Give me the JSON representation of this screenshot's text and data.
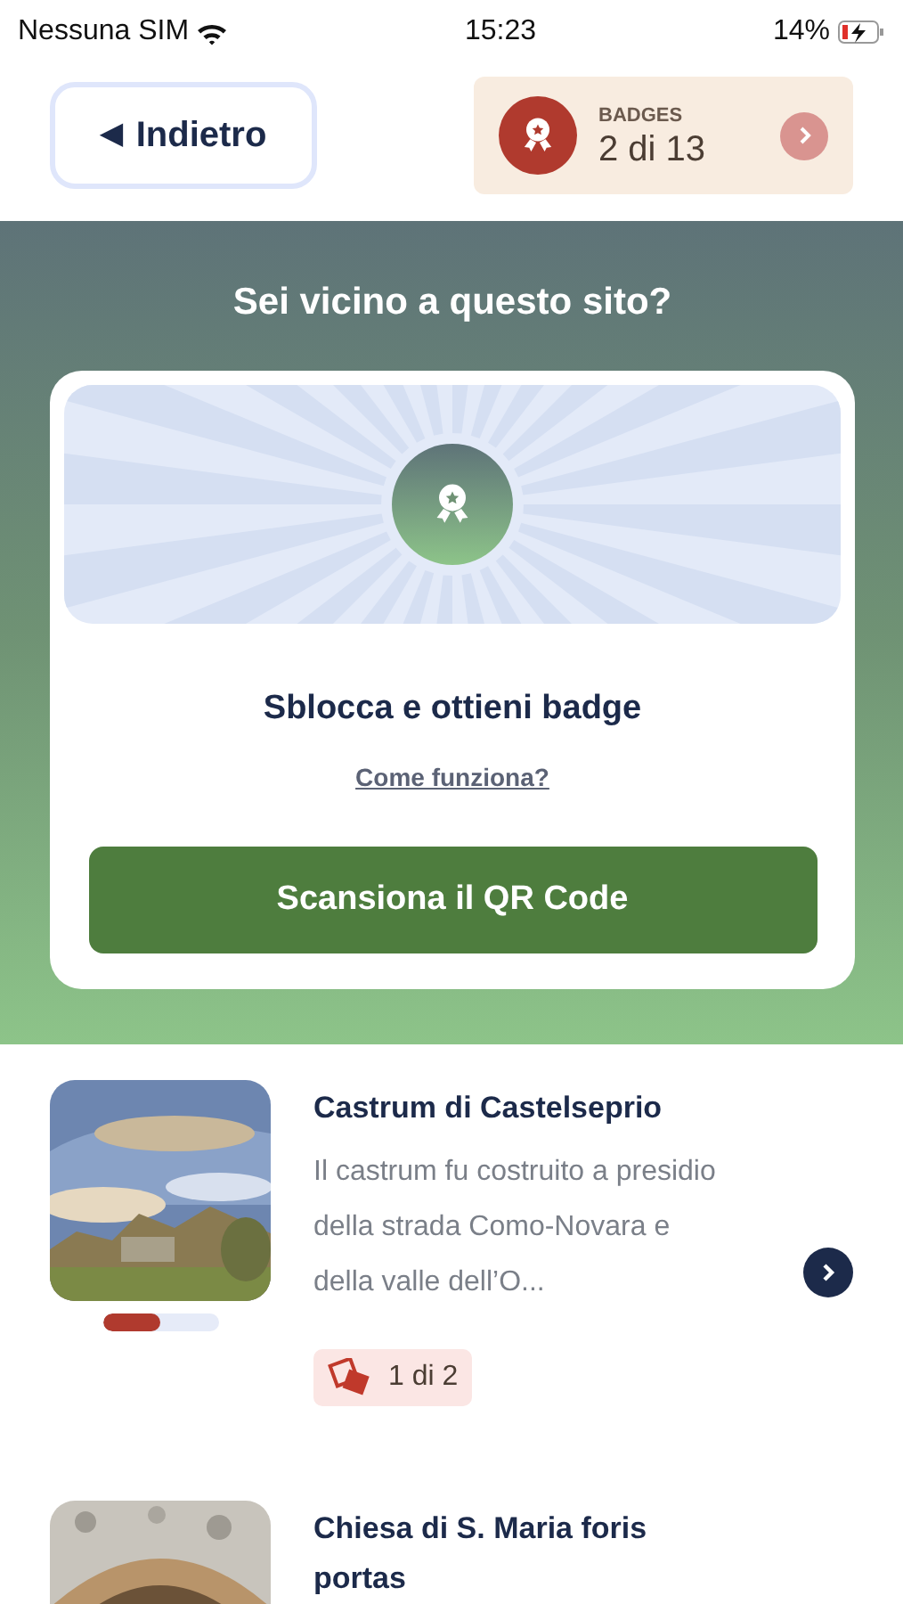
{
  "status_bar": {
    "carrier": "Nessuna SIM",
    "time": "15:23",
    "battery": "14%"
  },
  "header": {
    "back": {
      "icon": "◀",
      "label": "Indietro"
    },
    "badges": {
      "label": "BADGES",
      "count": "2 di 13"
    }
  },
  "hero": {
    "title": "Sei vicino a questo sito?",
    "card": {
      "title": "Sblocca e ottieni badge",
      "link": "Come funziona?",
      "button": "Scansiona il QR Code"
    }
  },
  "sites": [
    {
      "kind": "picture",
      "title": "Castrum di Castelseprio",
      "description": "Il castrum fu costruito a presidio della strada Como-Novara e della valle dell’O...",
      "level": 0.5,
      "badge_count": "1 di 2"
    },
    {
      "kind": "picture",
      "title": "Chiesa di S. Maria foris portas"
    }
  ]
}
